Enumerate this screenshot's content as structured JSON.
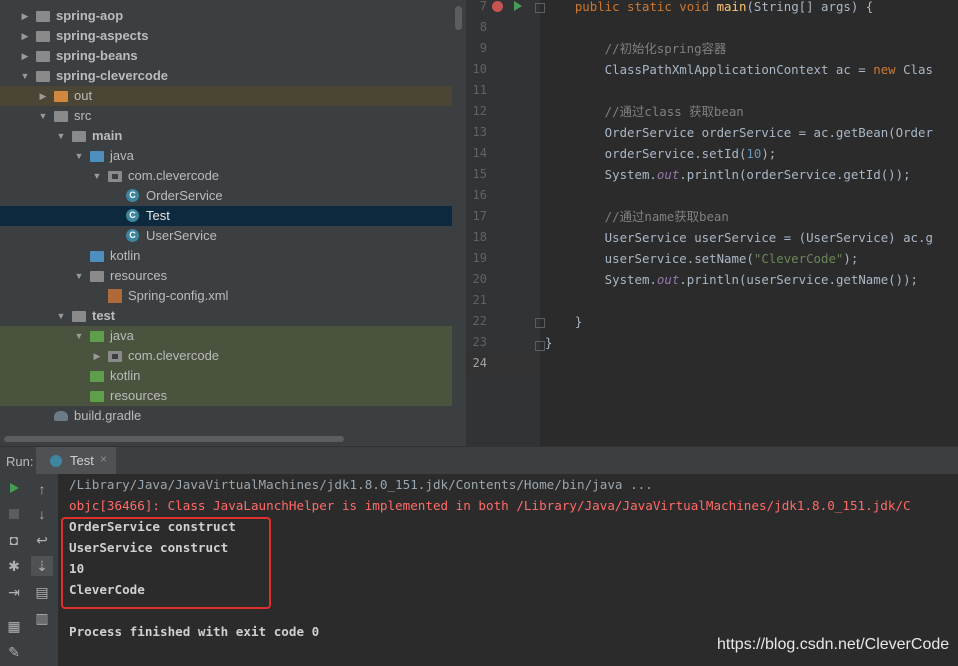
{
  "project_tree": {
    "items": [
      {
        "label": "spring-aop",
        "depth": 0,
        "expanded": false,
        "icon": "module-folder-icon",
        "bold": true
      },
      {
        "label": "spring-aspects",
        "depth": 0,
        "expanded": false,
        "icon": "module-folder-icon",
        "bold": true
      },
      {
        "label": "spring-beans",
        "depth": 0,
        "expanded": false,
        "icon": "module-folder-icon",
        "bold": true
      },
      {
        "label": "spring-clevercode",
        "depth": 0,
        "expanded": true,
        "icon": "module-folder-icon",
        "bold": true
      },
      {
        "label": "out",
        "depth": 1,
        "expanded": false,
        "icon": "excluded-folder-icon",
        "bold": false
      },
      {
        "label": "src",
        "depth": 1,
        "expanded": true,
        "icon": "folder-icon",
        "bold": false
      },
      {
        "label": "main",
        "depth": 2,
        "expanded": true,
        "icon": "folder-icon",
        "bold": true
      },
      {
        "label": "java",
        "depth": 3,
        "expanded": true,
        "icon": "source-folder-icon",
        "bold": false
      },
      {
        "label": "com.clevercode",
        "depth": 4,
        "expanded": true,
        "icon": "package-icon",
        "bold": false
      },
      {
        "label": "OrderService",
        "depth": 5,
        "expanded": null,
        "icon": "class-icon",
        "bold": false
      },
      {
        "label": "Test",
        "depth": 5,
        "expanded": null,
        "icon": "class-icon",
        "bold": false,
        "selected": true
      },
      {
        "label": "UserService",
        "depth": 5,
        "expanded": null,
        "icon": "class-icon",
        "bold": false
      },
      {
        "label": "kotlin",
        "depth": 3,
        "expanded": null,
        "icon": "source-folder-icon",
        "bold": false
      },
      {
        "label": "resources",
        "depth": 3,
        "expanded": true,
        "icon": "resources-folder-icon",
        "bold": false
      },
      {
        "label": "Spring-config.xml",
        "depth": 4,
        "expanded": null,
        "icon": "xml-file-icon",
        "bold": false
      },
      {
        "label": "test",
        "depth": 2,
        "expanded": true,
        "icon": "folder-icon",
        "bold": true
      },
      {
        "label": "java",
        "depth": 3,
        "expanded": true,
        "icon": "test-source-folder-icon",
        "bold": false
      },
      {
        "label": "com.clevercode",
        "depth": 4,
        "expanded": false,
        "icon": "package-icon",
        "bold": false
      },
      {
        "label": "kotlin",
        "depth": 3,
        "expanded": null,
        "icon": "test-source-folder-icon",
        "bold": false
      },
      {
        "label": "resources",
        "depth": 3,
        "expanded": null,
        "icon": "test-resources-folder-icon",
        "bold": false
      },
      {
        "label": "build.gradle",
        "depth": 1,
        "expanded": null,
        "icon": "gradle-icon",
        "bold": false
      }
    ]
  },
  "editor": {
    "line_numbers": [
      "7",
      "8",
      "9",
      "10",
      "11",
      "12",
      "13",
      "14",
      "15",
      "16",
      "17",
      "18",
      "19",
      "20",
      "21",
      "22",
      "23",
      "24"
    ],
    "current_line": "24",
    "lines": [
      [
        {
          "t": "    "
        },
        {
          "t": "public static void ",
          "c": "kw"
        },
        {
          "t": "main",
          "c": "fn"
        },
        {
          "t": "(String[] args) {"
        }
      ],
      [],
      [
        {
          "t": "        //初始化spring容器",
          "c": "cm"
        }
      ],
      [
        {
          "t": "        ClassPathXmlApplicationContext ac = "
        },
        {
          "t": "new ",
          "c": "kw"
        },
        {
          "t": "Clas"
        }
      ],
      [],
      [
        {
          "t": "        //通过class 获取bean",
          "c": "cm"
        }
      ],
      [
        {
          "t": "        OrderService orderService = ac.getBean(Order"
        }
      ],
      [
        {
          "t": "        orderService.setId("
        },
        {
          "t": "10",
          "c": "num"
        },
        {
          "t": ");"
        }
      ],
      [
        {
          "t": "        System."
        },
        {
          "t": "out",
          "c": "fld"
        },
        {
          "t": ".println(orderService.getId());"
        }
      ],
      [],
      [
        {
          "t": "        //通过name获取bean",
          "c": "cm"
        }
      ],
      [
        {
          "t": "        UserService userService = (UserService) ac.g"
        }
      ],
      [
        {
          "t": "        userService.setName("
        },
        {
          "t": "\"CleverCode\"",
          "c": "str"
        },
        {
          "t": ");"
        }
      ],
      [
        {
          "t": "        System."
        },
        {
          "t": "out",
          "c": "fld"
        },
        {
          "t": ".println(userService.getName());"
        }
      ],
      [],
      [
        {
          "t": "    }"
        }
      ],
      [
        {
          "t": "}"
        }
      ],
      []
    ]
  },
  "run_panel": {
    "label": "Run:",
    "tab_label": "Test",
    "tab_close": "×",
    "console_lines": [
      {
        "text": "/Library/Java/JavaVirtualMachines/jdk1.8.0_151.jdk/Contents/Home/bin/java ...",
        "kind": "cmd"
      },
      {
        "text": "objc[36466]: Class JavaLaunchHelper is implemented in both /Library/Java/JavaVirtualMachines/jdk1.8.0_151.jdk/C",
        "kind": "err"
      },
      {
        "text": "OrderService construct",
        "kind": "out"
      },
      {
        "text": "UserService construct",
        "kind": "out"
      },
      {
        "text": "10",
        "kind": "out"
      },
      {
        "text": "CleverCode",
        "kind": "out"
      },
      {
        "text": "",
        "kind": "out"
      },
      {
        "text": "Process finished with exit code 0",
        "kind": "out"
      }
    ],
    "toolbar_icons": [
      "run-icon",
      "up-arrow-icon",
      "stop-icon",
      "down-arrow-icon",
      "camera-icon",
      "soft-wrap-icon",
      "bug-icon",
      "scroll-to-end-icon",
      "exit-icon",
      "print-icon",
      "layout-icon",
      "trash-icon",
      "pin-icon"
    ]
  },
  "colors": {
    "highlight_box": "#e0302d",
    "selection": "#0d293e",
    "keyword": "#cc7832",
    "method": "#ffc66d",
    "comment": "#808080",
    "number": "#6897bb",
    "string": "#6a8759",
    "error_text": "#ff6b68"
  },
  "watermark": "https://blog.csdn.net/CleverCode"
}
